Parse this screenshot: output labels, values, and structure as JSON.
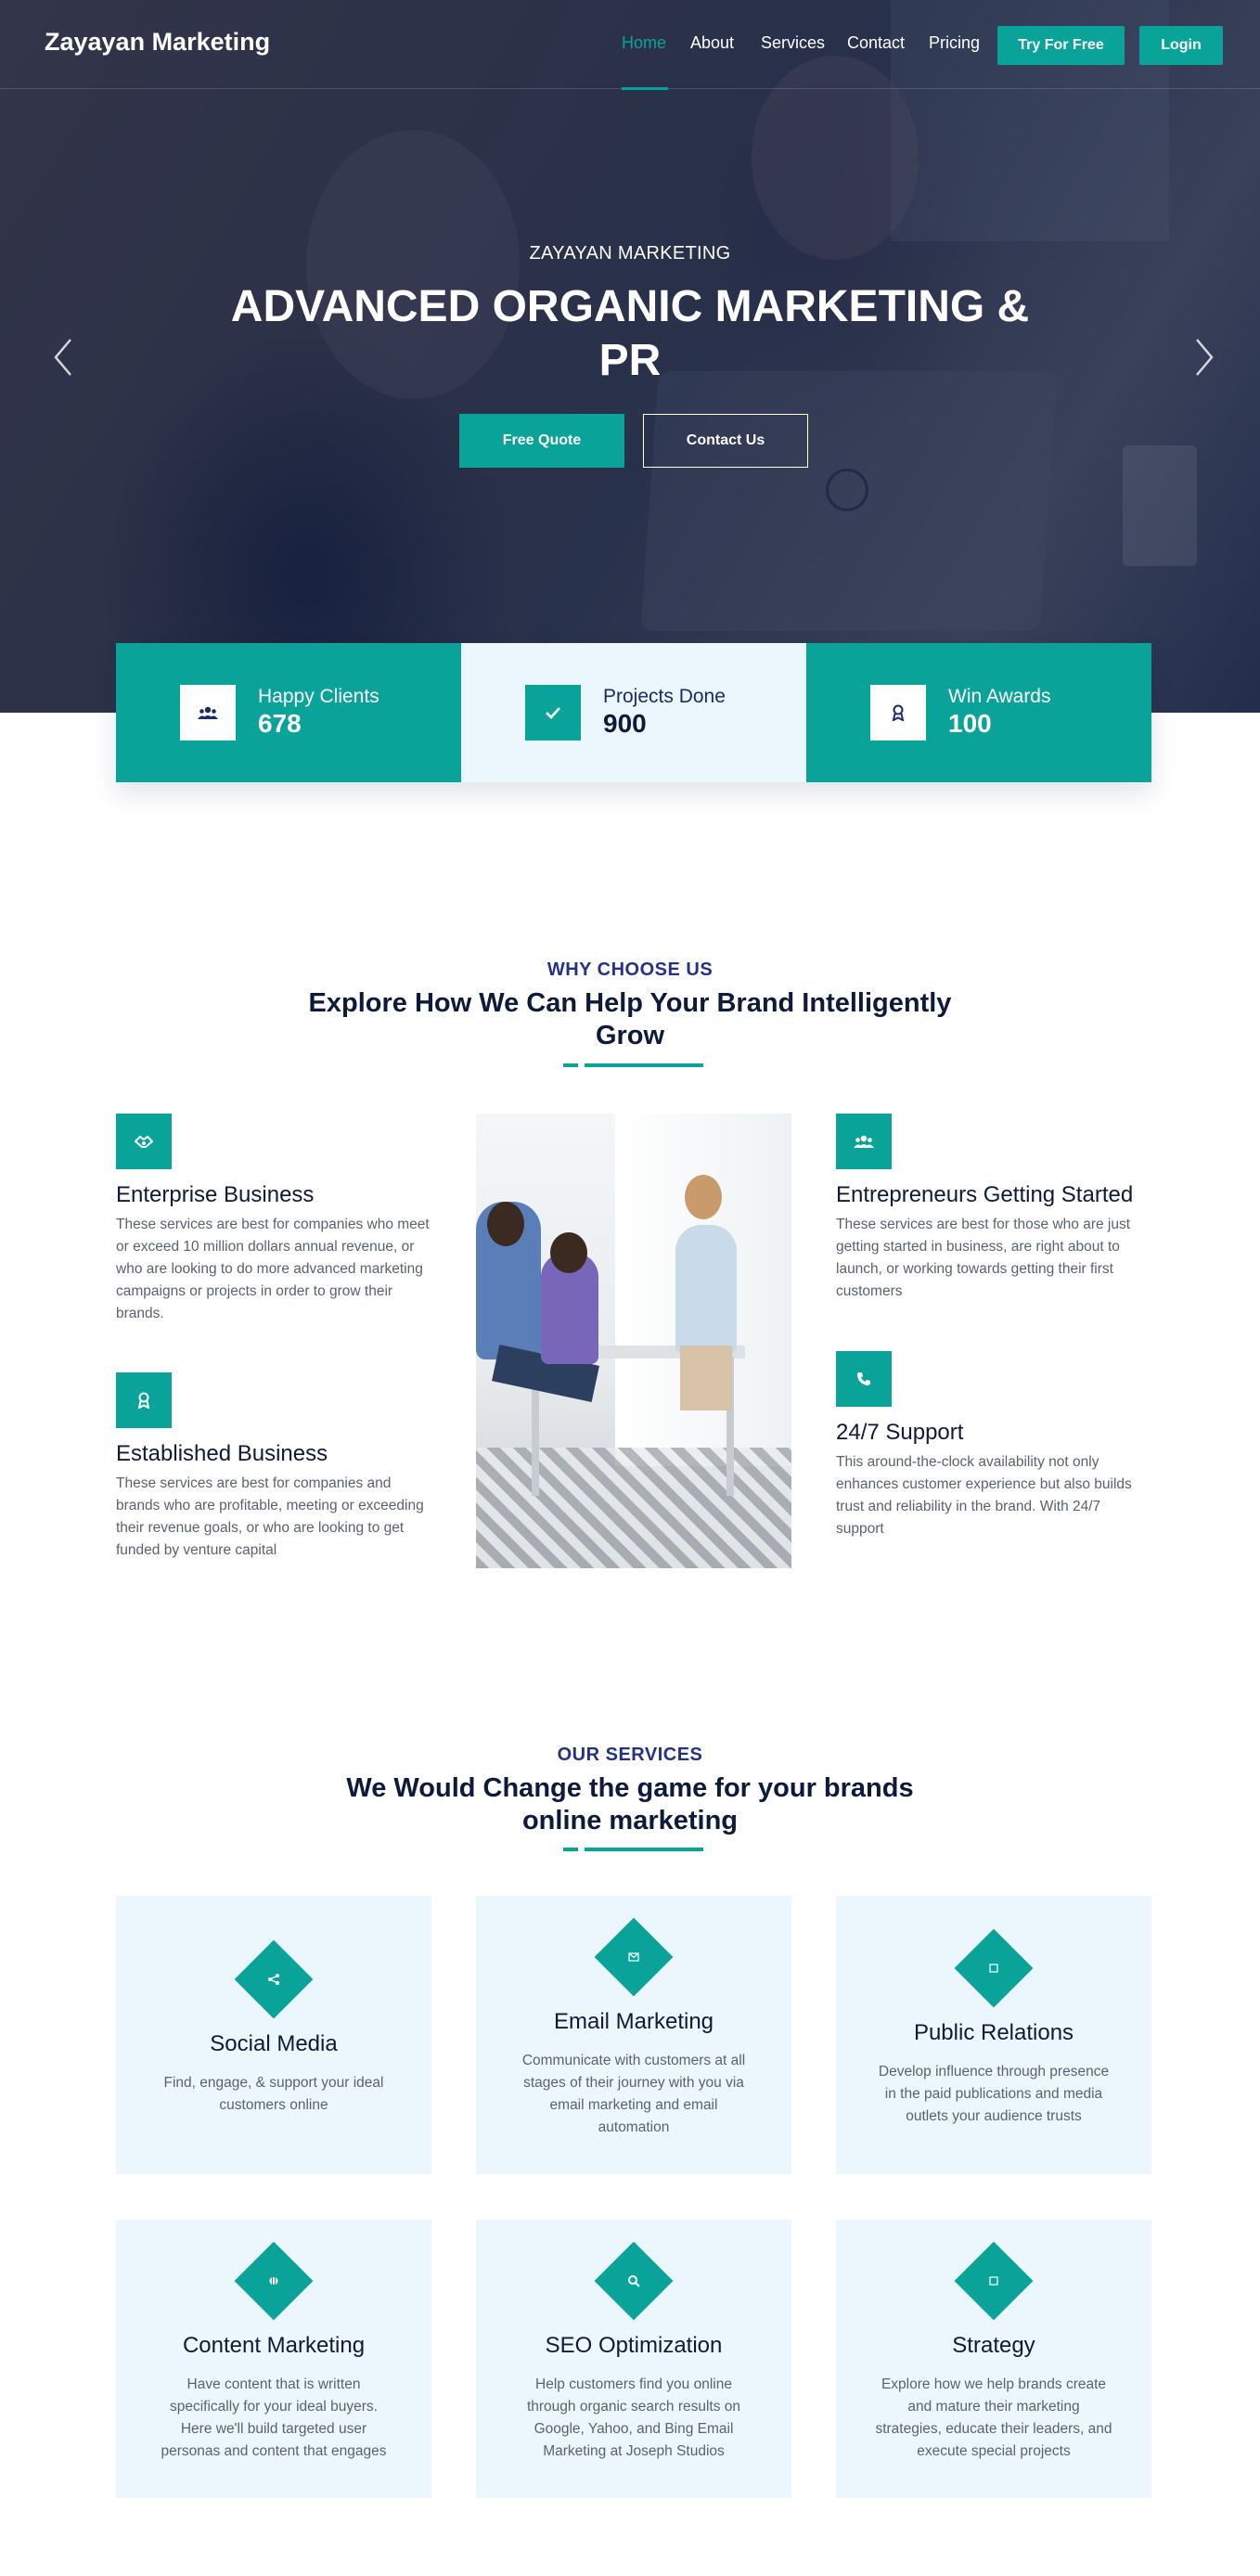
{
  "colors": {
    "accent": "#0aa39a",
    "navy": "#23318a",
    "dark": "#0e1a3a",
    "card_bg": "#ecf6fd"
  },
  "nav": {
    "logo": "Zayayan Marketing",
    "links": [
      "Home",
      "About",
      "Services",
      "Contact",
      "Pricing"
    ],
    "try_label": "Try For Free",
    "login_label": "Login"
  },
  "hero": {
    "subtitle": "ZAYAYAN MARKETING",
    "title": "ADVANCED ORGANIC MARKETING & PR",
    "primary_btn": "Free Quote",
    "secondary_btn": "Contact Us",
    "prev_icon": "chevron-left-icon",
    "next_icon": "chevron-right-icon"
  },
  "stats": [
    {
      "icon": "users-icon",
      "label": "Happy Clients",
      "value": "678"
    },
    {
      "icon": "check-icon",
      "label": "Projects Done",
      "value": "900"
    },
    {
      "icon": "award-icon",
      "label": "Win Awards",
      "value": "100"
    }
  ],
  "why": {
    "eyebrow": "WHY CHOOSE US",
    "title": "Explore How We Can Help Your Brand Intelligently Grow",
    "features": [
      {
        "icon": "handshake-icon",
        "title": "Enterprise Business",
        "desc": "These services are best for companies who meet or exceed 10 million dollars annual revenue, or who are looking to do more advanced marketing campaigns or projects in order to grow their brands."
      },
      {
        "icon": "award-icon",
        "title": "Established Business",
        "desc": "These services are best for companies and brands who are profitable, meeting or exceeding their revenue goals, or who are looking to get funded by venture capital"
      },
      {
        "icon": "users-icon",
        "title": "Entrepreneurs Getting Started",
        "desc": "These services are best for those who are just getting started in business, are right about to launch, or working towards getting their first customers"
      },
      {
        "icon": "phone-icon",
        "title": "24/7 Support",
        "desc": "This around-the-clock availability not only enhances customer experience but also builds trust and reliability in the brand. With 24/7 support"
      }
    ]
  },
  "services": {
    "eyebrow": "OUR SERVICES",
    "title": "We Would Change the game for your brands online marketing",
    "cards": [
      {
        "icon": "share-icon",
        "title": "Social Media",
        "desc": "Find, engage, & support your ideal customers online"
      },
      {
        "icon": "envelope-icon",
        "title": "Email Marketing",
        "desc": "Communicate with customers at all stages of their journey with you via email marketing and email automation"
      },
      {
        "icon": "megaphone-icon",
        "title": "Public Relations",
        "desc": "Develop influence through presence in the paid publications and media outlets your audience trusts"
      },
      {
        "icon": "content-icon",
        "title": "Content Marketing",
        "desc": "Have content that is written specifically for your ideal buyers. Here we'll build targeted user personas and content that engages"
      },
      {
        "icon": "search-icon",
        "title": "SEO Optimization",
        "desc": "Help customers find you online through organic search results on Google, Yahoo, and Bing Email Marketing at Joseph Studios"
      },
      {
        "icon": "strategy-icon",
        "title": "Strategy",
        "desc": "Explore how we help brands create and mature their marketing strategies, educate their leaders, and execute special projects"
      }
    ]
  }
}
